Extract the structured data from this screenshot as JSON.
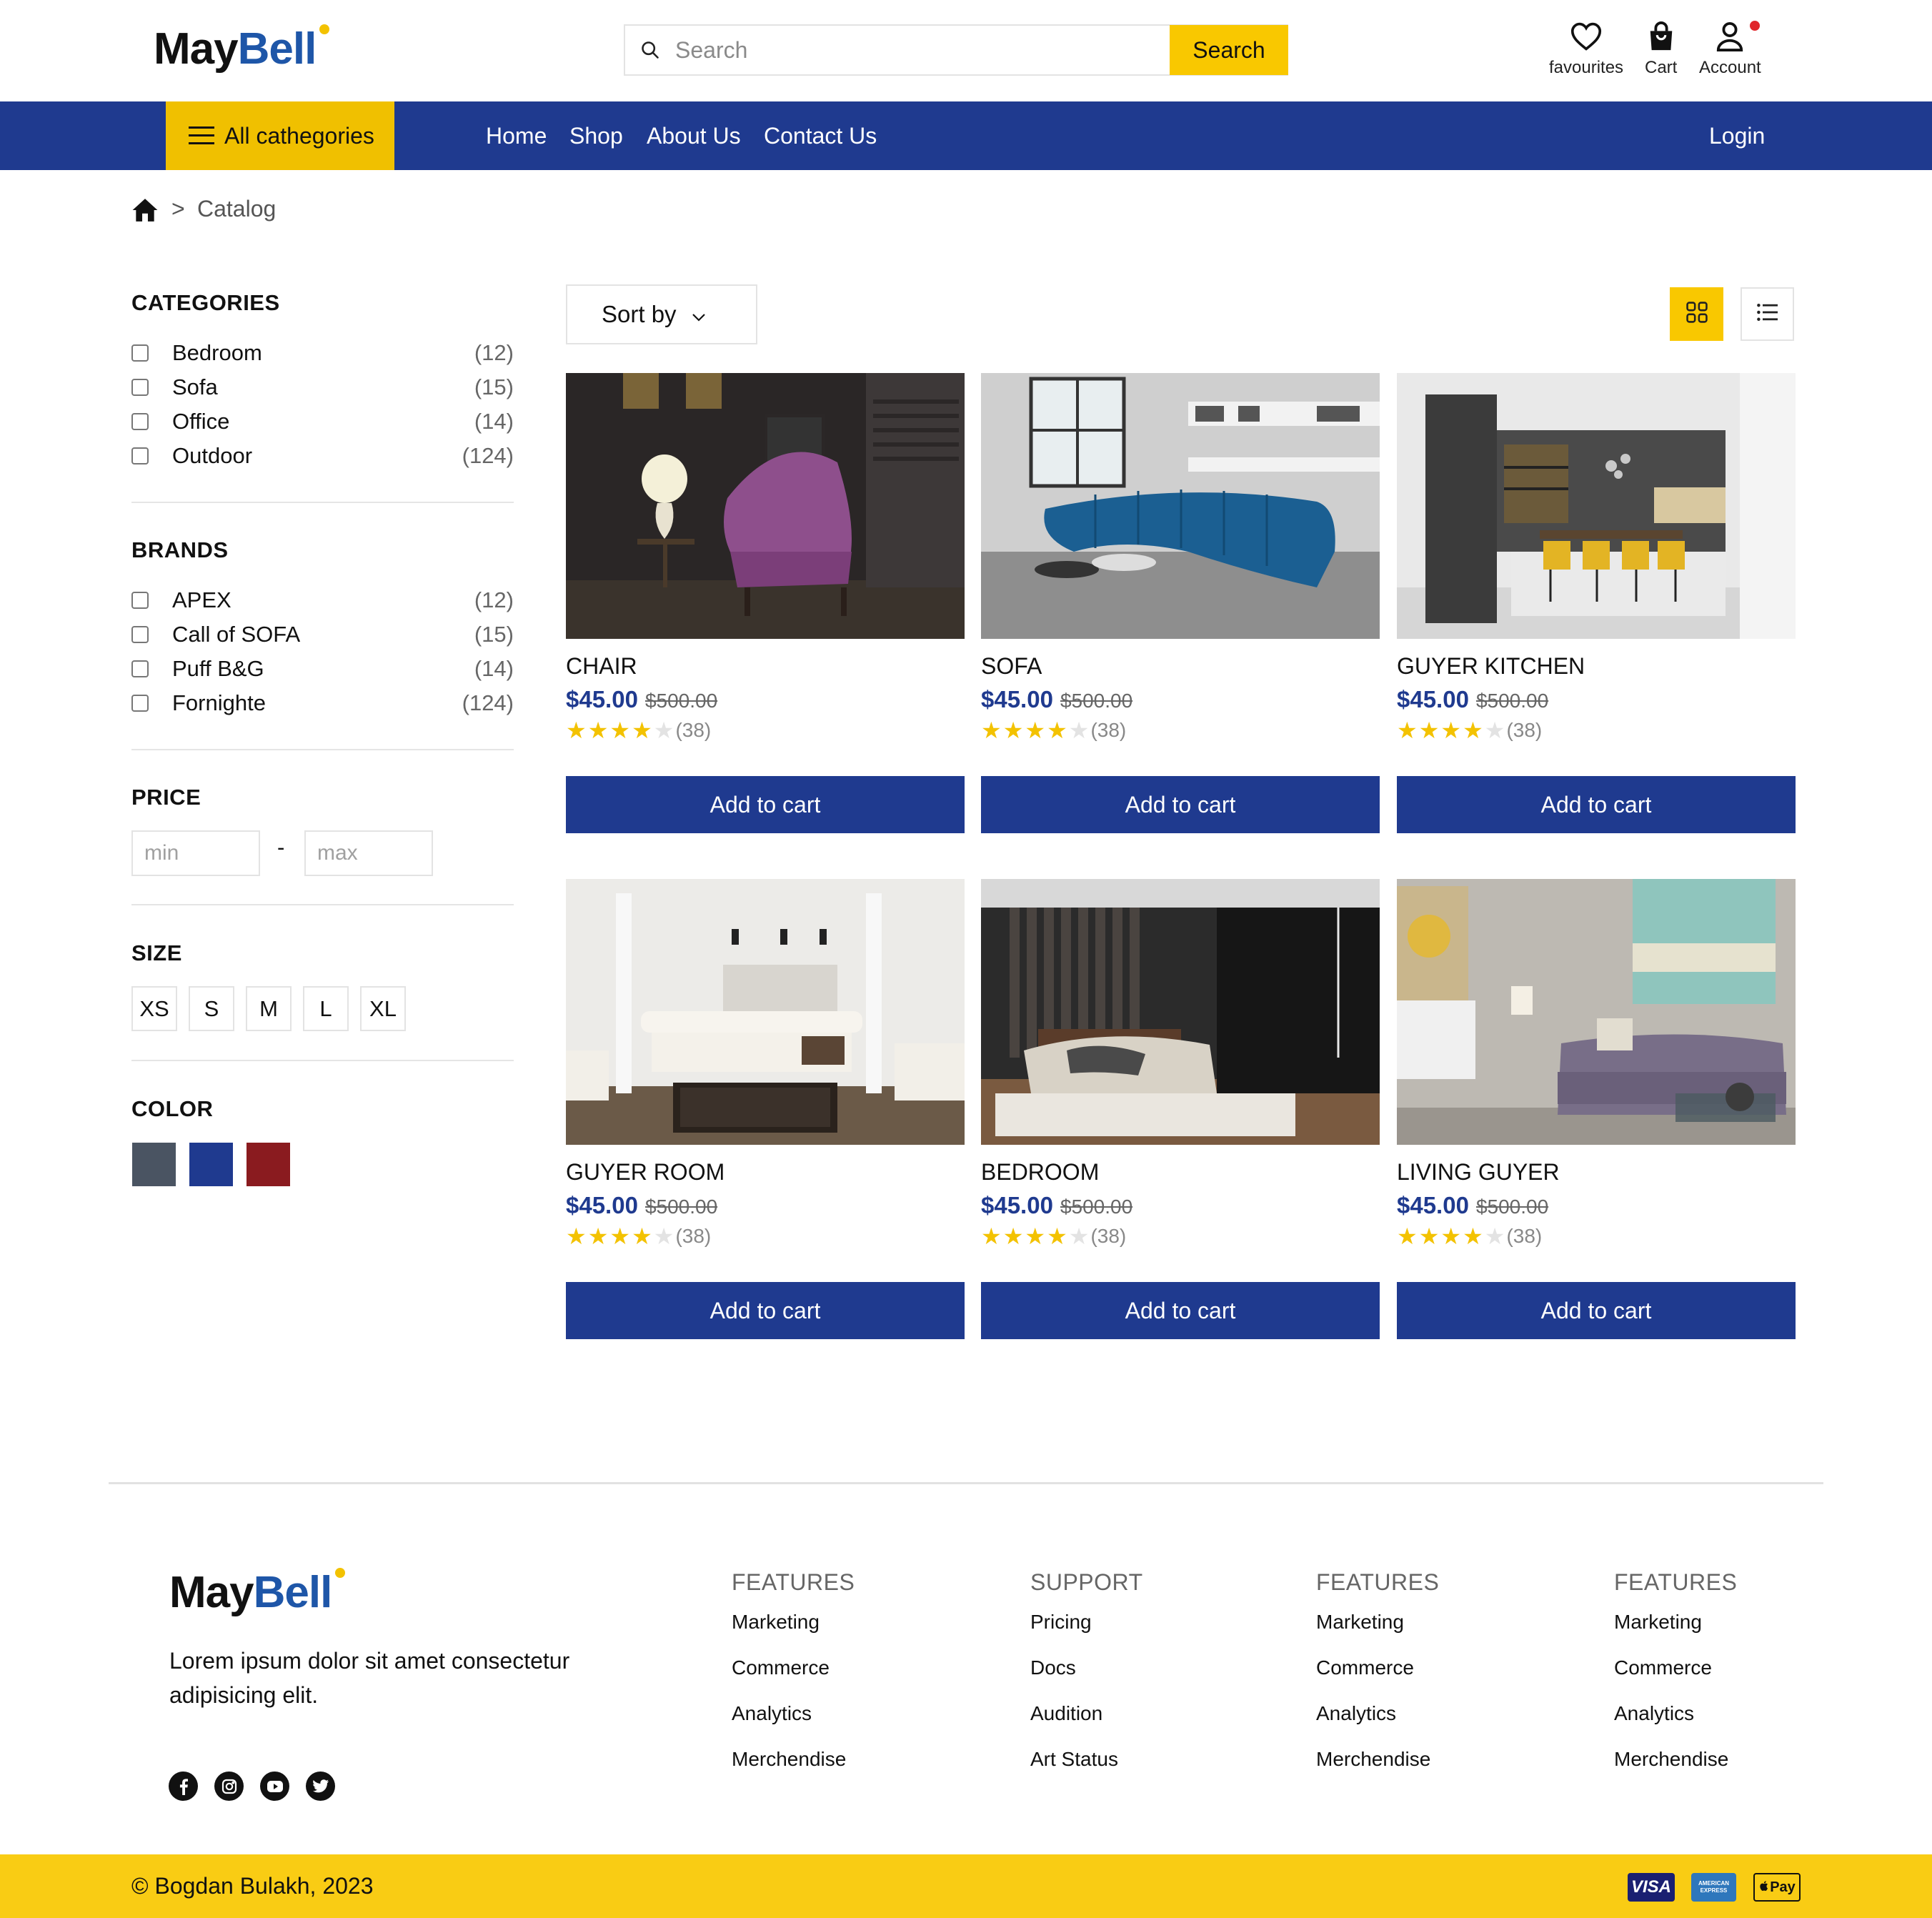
{
  "brand": {
    "name_part1": "May",
    "name_part2": "Bell",
    "accent": "#f3c200",
    "blue": "#1e56a8"
  },
  "header": {
    "search": {
      "placeholder": "Search",
      "button_label": "Search"
    },
    "icons": [
      {
        "icon": "heart-icon",
        "label": "favourites"
      },
      {
        "icon": "bag-icon",
        "label": "Cart"
      },
      {
        "icon": "user-icon",
        "label": "Account"
      }
    ]
  },
  "nav": {
    "categories_label": "All cathegories",
    "links": [
      "Home",
      "Shop",
      "About Us",
      "Contact Us"
    ],
    "login_label": "Login",
    "bg": "#1f3a8f",
    "cat_bg": "#f0c000"
  },
  "breadcrumb": {
    "separator": ">",
    "current": "Catalog"
  },
  "sidebar": {
    "categories": {
      "title": "CATEGORIES",
      "items": [
        {
          "name": "Bedroom",
          "count": "(12)"
        },
        {
          "name": "Sofa",
          "count": "(15)"
        },
        {
          "name": "Office",
          "count": "(14)"
        },
        {
          "name": "Outdoor",
          "count": "(124)"
        }
      ]
    },
    "brands": {
      "title": "BRANDS",
      "items": [
        {
          "name": "APEX",
          "count": "(12)"
        },
        {
          "name": "Call of SOFA",
          "count": "(15)"
        },
        {
          "name": "Puff B&G",
          "count": "(14)"
        },
        {
          "name": "Fornighte",
          "count": "(124)"
        }
      ]
    },
    "price": {
      "title": "PRICE",
      "min_placeholder": "min",
      "max_placeholder": "max",
      "separator": "-"
    },
    "size": {
      "title": "SIZE",
      "options": [
        "XS",
        "S",
        "M",
        "L",
        "XL"
      ]
    },
    "color": {
      "title": "COLOR",
      "swatches": [
        "#4a5462",
        "#1f3a8f",
        "#8a1b1f"
      ]
    }
  },
  "toolbar": {
    "sort_label": "Sort by",
    "view_active": "grid"
  },
  "products": [
    {
      "title": "CHAIR",
      "price": "$45.00",
      "old_price": "$500.00",
      "rating": 4,
      "reviews": "(38)",
      "button": "Add to cart"
    },
    {
      "title": "SOFA",
      "price": "$45.00",
      "old_price": "$500.00",
      "rating": 4,
      "reviews": "(38)",
      "button": "Add to cart"
    },
    {
      "title": "GUYER KITCHEN",
      "price": "$45.00",
      "old_price": "$500.00",
      "rating": 4,
      "reviews": "(38)",
      "button": "Add to cart"
    },
    {
      "title": "GUYER ROOM",
      "price": "$45.00",
      "old_price": "$500.00",
      "rating": 4,
      "reviews": "(38)",
      "button": "Add to cart"
    },
    {
      "title": "BEDROOM",
      "price": "$45.00",
      "old_price": "$500.00",
      "rating": 4,
      "reviews": "(38)",
      "button": "Add to cart"
    },
    {
      "title": "LIVING GUYER",
      "price": "$45.00",
      "old_price": "$500.00",
      "rating": 4,
      "reviews": "(38)",
      "button": "Add to cart"
    }
  ],
  "footer": {
    "description": "Lorem ipsum dolor sit amet consectetur adipisicing elit.",
    "social": [
      "facebook-icon",
      "instagram-icon",
      "youtube-icon",
      "twitter-icon"
    ],
    "columns": [
      {
        "title": "FEATURES",
        "items": [
          "Marketing",
          "Commerce",
          "Analytics",
          "Merchendise"
        ]
      },
      {
        "title": "SUPPORT",
        "items": [
          "Pricing",
          "Docs",
          "Audition",
          "Art Status"
        ]
      },
      {
        "title": "FEATURES",
        "items": [
          "Marketing",
          "Commerce",
          "Analytics",
          "Merchendise"
        ]
      },
      {
        "title": "FEATURES",
        "items": [
          "Marketing",
          "Commerce",
          "Analytics",
          "Merchendise"
        ]
      }
    ],
    "copyright": "© Bogdan Bulakh, 2023",
    "payments": [
      {
        "name": "visa-logo",
        "label": "VISA"
      },
      {
        "name": "amex-logo",
        "label": "AMERICAN EXPRESS"
      },
      {
        "name": "apple-pay-logo",
        "label": "Pay"
      }
    ],
    "bar_bg": "#f9cc14"
  }
}
